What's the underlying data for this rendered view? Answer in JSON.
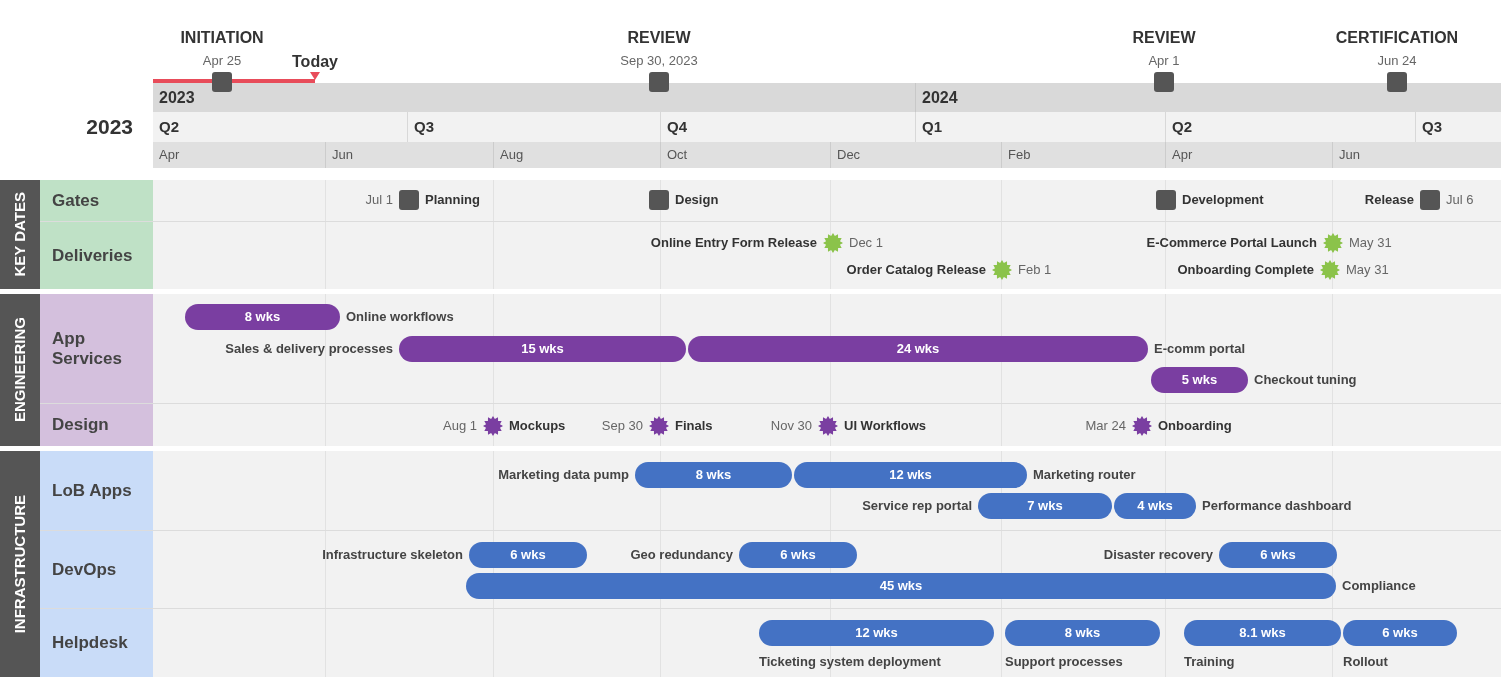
{
  "phases": [
    {
      "title": "INITIATION",
      "date": "Apr 25"
    },
    {
      "title": "REVIEW",
      "date": "Sep 30, 2023"
    },
    {
      "title": "REVIEW",
      "date": "Apr 1"
    },
    {
      "title": "CERTIFICATION",
      "date": "Jun 24"
    }
  ],
  "today": {
    "label": "Today"
  },
  "year_label": "2023",
  "timescale": {
    "years": [
      "2023",
      "2024"
    ],
    "quarters": [
      "Q2",
      "Q3",
      "Q4",
      "Q1",
      "Q2",
      "Q3"
    ],
    "months": [
      "Apr",
      "Jun",
      "Aug",
      "Oct",
      "Dec",
      "Feb",
      "Apr",
      "Jun"
    ]
  },
  "groups": [
    {
      "name": "KEY DATES",
      "color": "#bfe1c6",
      "lanes": [
        {
          "name": "Gates",
          "lines": [
            [
              {
                "kind": "gate",
                "label": "Planning",
                "date": "Jul 1",
                "label_first": false
              },
              {
                "kind": "gate",
                "label": "Design",
                "label_first": false
              },
              {
                "kind": "gate",
                "label": "Development",
                "label_first": false
              },
              {
                "kind": "gate",
                "label": "Release",
                "date": "Jul 6",
                "label_first": true
              }
            ]
          ]
        },
        {
          "name": "Deliveries",
          "lines": [
            [
              {
                "kind": "delivery",
                "label": "Online Entry Form Release",
                "date": "Dec 1",
                "label_first": true
              },
              {
                "kind": "delivery",
                "label": "E-Commerce Portal Launch",
                "date": "May 31",
                "label_first": true
              }
            ],
            [
              {
                "kind": "delivery",
                "label": "Order Catalog Release",
                "date": "Feb 1",
                "label_first": true
              },
              {
                "kind": "delivery",
                "label": "Onboarding Complete",
                "date": "May 31",
                "label_first": true
              }
            ]
          ]
        }
      ]
    },
    {
      "name": "ENGINEERING",
      "color": "#d4c0dd",
      "lanes": [
        {
          "name": "App Services",
          "lines": [
            [
              {
                "kind": "bar",
                "duration": "8 wks",
                "label": "Online workflows",
                "label_first": false
              }
            ],
            [
              {
                "kind": "bar",
                "duration": "15 wks",
                "label": "Sales & delivery processes",
                "label_first": true
              },
              {
                "kind": "bar",
                "duration": "24 wks",
                "label": "E-comm portal",
                "label_first": false
              }
            ],
            [
              {
                "kind": "bar",
                "duration": "5 wks",
                "label": "Checkout tuning",
                "label_first": false
              }
            ]
          ]
        },
        {
          "name": "Design",
          "lines": [
            [
              {
                "kind": "milestone",
                "label": "Mockups",
                "date": "Aug 1",
                "label_first": false
              },
              {
                "kind": "milestone",
                "label": "Finals",
                "date": "Sep 30",
                "label_first": false
              },
              {
                "kind": "milestone",
                "label": "UI Workflows",
                "date": "Nov 30",
                "label_first": false
              },
              {
                "kind": "milestone",
                "label": "Onboarding",
                "date": "Mar 24",
                "label_first": false
              }
            ]
          ]
        }
      ]
    },
    {
      "name": "INFRASTRUCTURE",
      "color": "#c9dcf8",
      "lanes": [
        {
          "name": "LoB Apps",
          "lines": [
            [
              {
                "kind": "bar",
                "duration": "8 wks",
                "label": "Marketing data pump",
                "label_first": true
              },
              {
                "kind": "bar",
                "duration": "12 wks",
                "label": "Marketing router",
                "label_first": false
              }
            ],
            [
              {
                "kind": "bar",
                "duration": "7 wks",
                "label": "Service rep portal",
                "label_first": true
              },
              {
                "kind": "bar",
                "duration": "4 wks",
                "label": "Performance dashboard",
                "label_first": false
              }
            ]
          ]
        },
        {
          "name": "DevOps",
          "lines": [
            [
              {
                "kind": "bar",
                "duration": "6 wks",
                "label": "Infrastructure skeleton",
                "label_first": true
              },
              {
                "kind": "bar",
                "duration": "6 wks",
                "label": "Geo redundancy",
                "label_first": true
              },
              {
                "kind": "bar",
                "duration": "6 wks",
                "label": "Disaster recovery",
                "label_first": true
              }
            ],
            [
              {
                "kind": "bar",
                "duration": "45 wks",
                "label": "Compliance",
                "label_first": false
              }
            ]
          ]
        },
        {
          "name": "Helpdesk",
          "lines": [
            [
              {
                "kind": "bar_label_below",
                "duration": "12 wks",
                "label": "Ticketing system deployment"
              },
              {
                "kind": "bar_label_below",
                "duration": "8 wks",
                "label": "Support processes"
              },
              {
                "kind": "bar_label_below",
                "duration": "8.1 wks",
                "label": "Training"
              },
              {
                "kind": "bar_label_below",
                "duration": "6 wks",
                "label": "Rollout"
              }
            ]
          ]
        }
      ]
    }
  ]
}
